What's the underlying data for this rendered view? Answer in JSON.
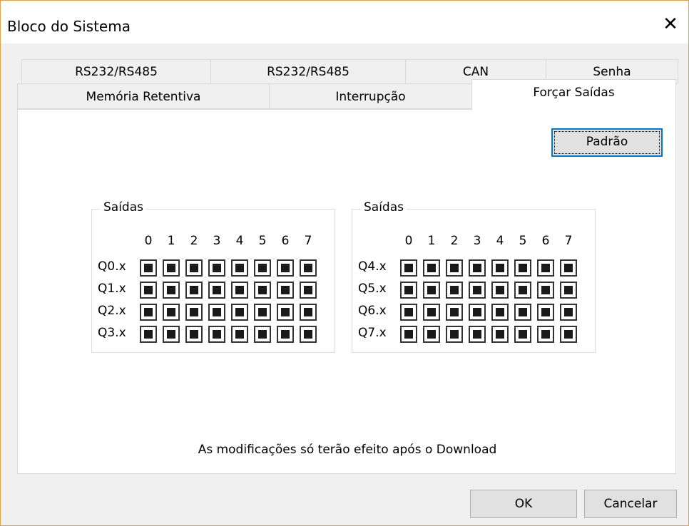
{
  "window": {
    "title": "Bloco do Sistema",
    "close_glyph": "✕"
  },
  "tabs": {
    "row1": [
      "RS232/RS485",
      "RS232/RS485",
      "CAN",
      "Senha"
    ],
    "row2": [
      "Memória Retentiva",
      "Interrupção",
      "Forçar Saídas"
    ],
    "active": "Forçar Saídas"
  },
  "panel": {
    "default_button": "Padrão",
    "groups": [
      {
        "title": "Saídas",
        "bits": [
          "0",
          "1",
          "2",
          "3",
          "4",
          "5",
          "6",
          "7"
        ],
        "rows": [
          "Q0.x",
          "Q1.x",
          "Q2.x",
          "Q3.x"
        ]
      },
      {
        "title": "Saídas",
        "bits": [
          "0",
          "1",
          "2",
          "3",
          "4",
          "5",
          "6",
          "7"
        ],
        "rows": [
          "Q4.x",
          "Q5.x",
          "Q6.x",
          "Q7.x"
        ]
      }
    ],
    "checkbox_state": "indeterminate",
    "note": "As modificações só terão efeito após o Download"
  },
  "footer": {
    "ok": "OK",
    "cancel": "Cancelar"
  },
  "colors": {
    "accent": "#0078d7",
    "window_border": "#e8a042",
    "panel_bg": "#ffffff",
    "dialog_bg": "#f0f0f0"
  }
}
